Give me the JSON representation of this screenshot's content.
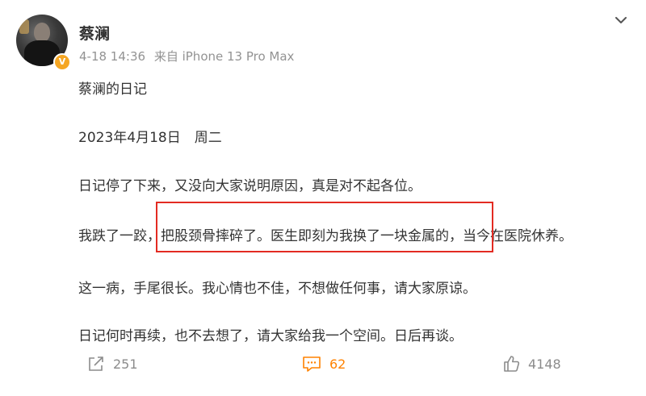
{
  "post": {
    "author": "蔡澜",
    "timestamp": "4-18 14:36",
    "source": "来自 iPhone 13 Pro Max",
    "lines": [
      "蔡澜的日记",
      "2023年4月18日　周二",
      "日记停了下来，又没向大家说明原因，真是对不起各位。",
      "我跌了一跤，把股颈骨摔碎了。医生即刻为我换了一块金属的，当今在医院休养。",
      "这一病，手尾很长。我心情也不佳，不想做任何事，请大家原谅。",
      "日记何时再续，也不去想了，请大家给我一个空间。日后再谈。"
    ]
  },
  "actions": {
    "share_count": "251",
    "comment_count": "62",
    "like_count": "4148"
  },
  "colors": {
    "accent": "#ff8200",
    "highlight_box": "#e32b22",
    "verify_badge": "#f5a623"
  },
  "icons": [
    "share-icon",
    "comment-icon",
    "like-icon",
    "chevron-down-icon",
    "verified-badge-icon"
  ]
}
